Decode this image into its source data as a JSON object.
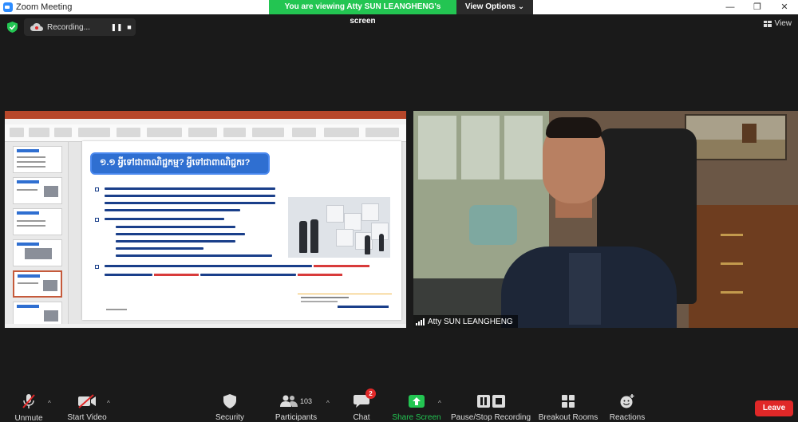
{
  "window": {
    "title": "Zoom Meeting",
    "controls": [
      "—",
      "❐",
      "✕"
    ]
  },
  "banner": {
    "viewing_text": "You are viewing Atty SUN LEANGHENG's screen",
    "view_options_label": "View Options ⌄"
  },
  "recording": {
    "label": "Recording...",
    "pause_icon": "❚❚",
    "stop_icon": "■"
  },
  "view_button": {
    "label": "View"
  },
  "shared_screen": {
    "slide_heading": "១.១ អ្វីទៅជាពាណិជ្ជកម្ម? អ្វីទៅជាពាណិជ្ជករ?"
  },
  "video": {
    "participant_name": "Atty SUN LEANGHENG"
  },
  "toolbar": {
    "unmute_label": "Unmute",
    "start_video_label": "Start Video",
    "security_label": "Security",
    "participants_label": "Participants",
    "participants_count": "103",
    "chat_label": "Chat",
    "chat_badge": "2",
    "share_screen_label": "Share Screen",
    "pause_stop_label": "Pause/Stop Recording",
    "breakout_label": "Breakout Rooms",
    "reactions_label": "Reactions",
    "leave_label": "Leave",
    "caret": "^"
  },
  "colors": {
    "viewing_banner": "#23c552",
    "leave_button": "#e02828",
    "share_screen": "#23c552",
    "powerpoint_title": "#b7472a",
    "slide_heading_bg": "#2f6fd1"
  }
}
